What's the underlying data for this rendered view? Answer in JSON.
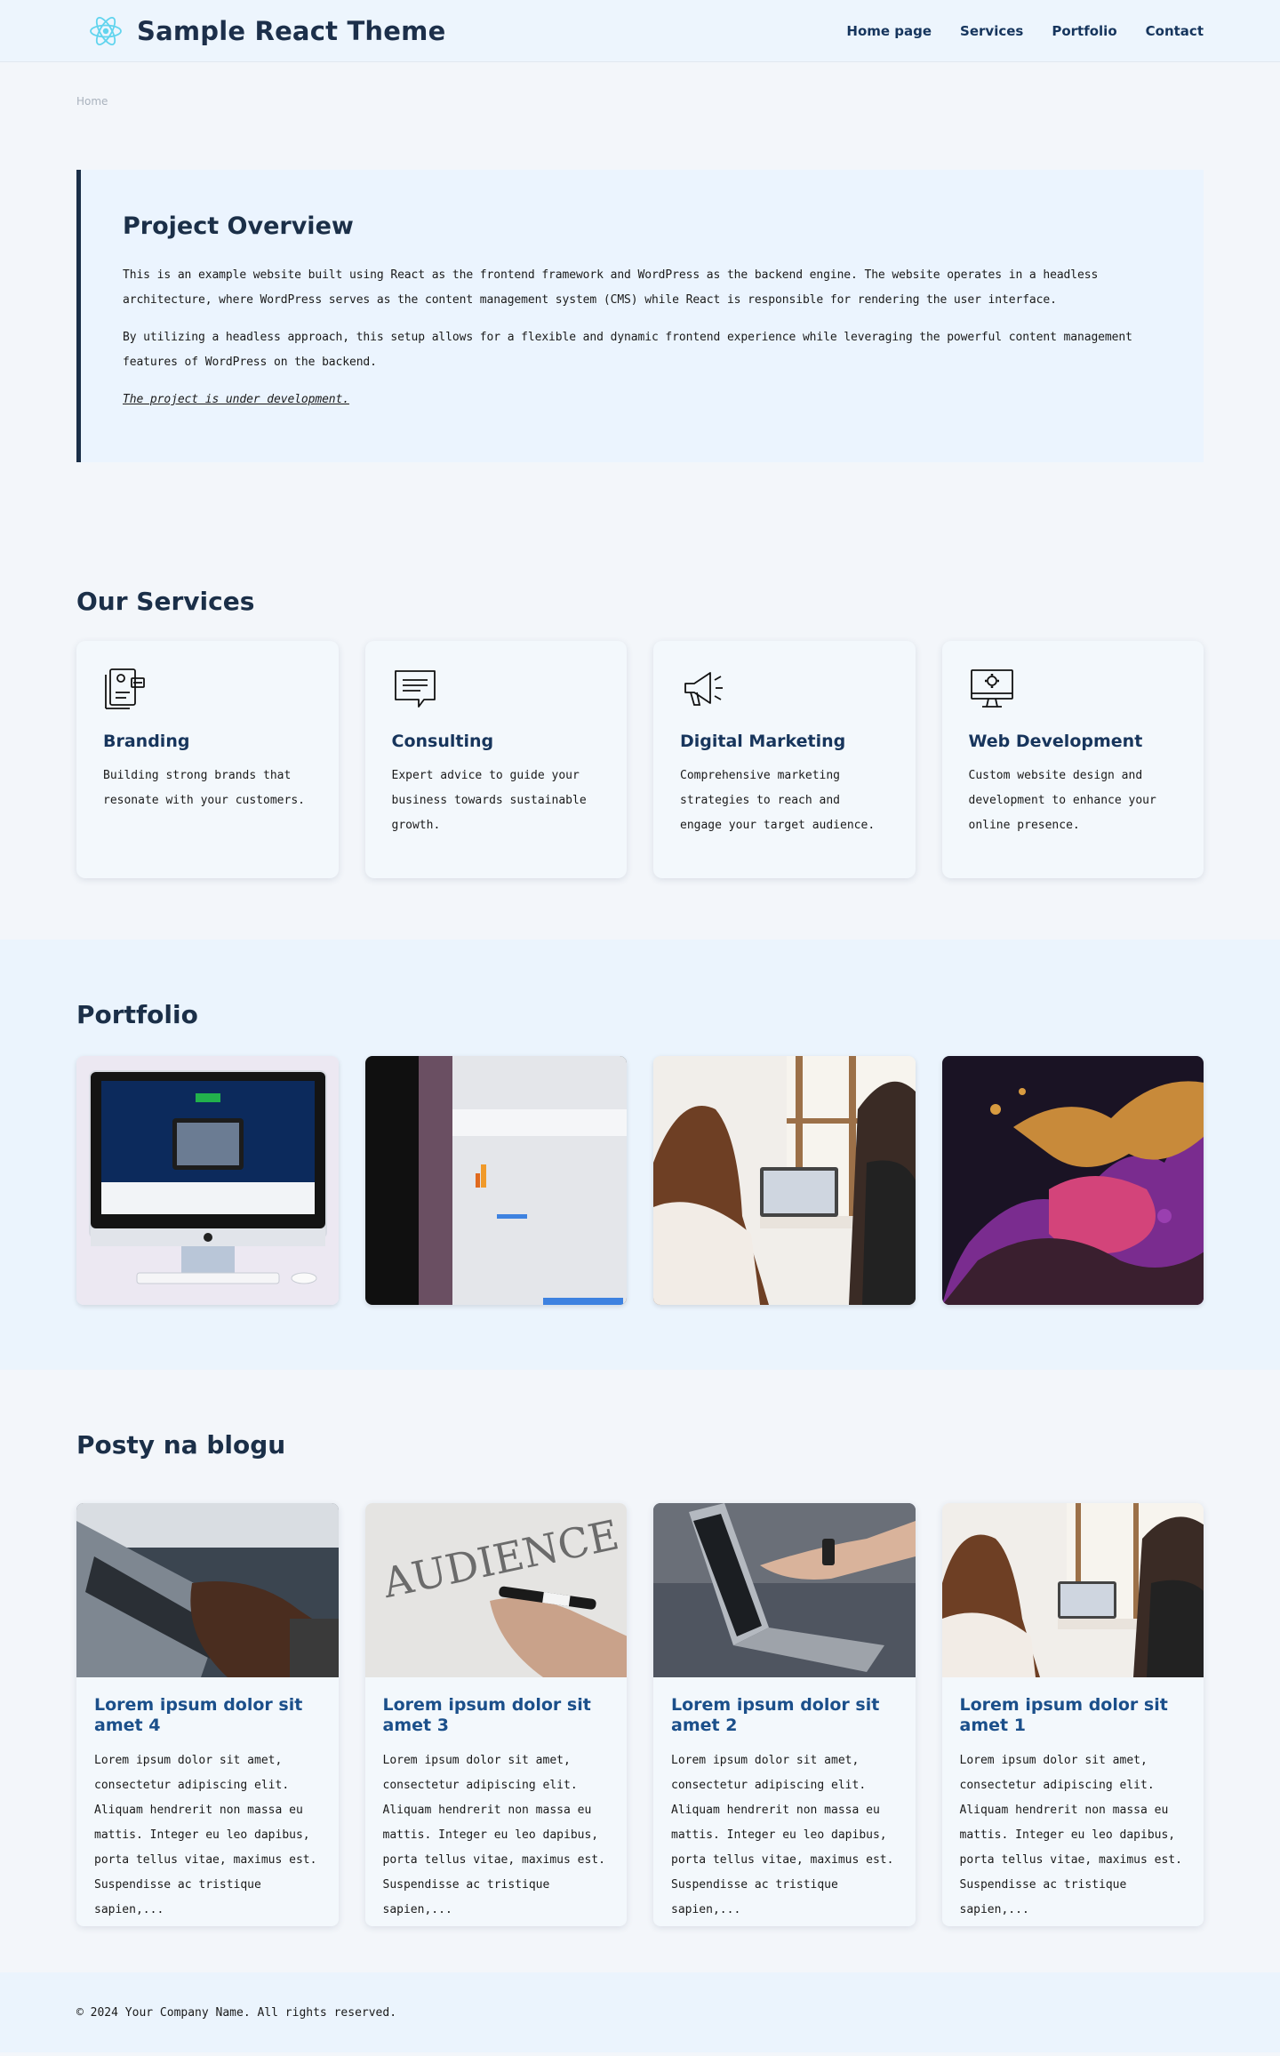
{
  "header": {
    "brand_title": "Sample React Theme",
    "logo_icon": "react-atom-icon",
    "nav": [
      {
        "label": "Home page"
      },
      {
        "label": "Services"
      },
      {
        "label": "Portfolio"
      },
      {
        "label": "Contact"
      }
    ]
  },
  "breadcrumb": "Home",
  "overview": {
    "title": "Project Overview",
    "p1": "This is an example website built using React as the frontend framework and WordPress as the backend engine. The website operates in a headless architecture, where WordPress serves as the content management system (CMS) while React is responsible for rendering the user interface.",
    "p2": "By utilizing a headless approach, this setup allows for a flexible and dynamic frontend experience while leveraging the powerful content management features of WordPress on the backend.",
    "note": "The project is under development."
  },
  "services": {
    "title": "Our Services",
    "items": [
      {
        "icon": "branding-icon",
        "title": "Branding",
        "text": "Building strong brands that resonate with your customers."
      },
      {
        "icon": "chat-bubble-icon",
        "title": "Consulting",
        "text": "Expert advice to guide your business towards sustainable growth."
      },
      {
        "icon": "megaphone-icon",
        "title": "Digital Marketing",
        "text": "Comprehensive marketing strategies to reach and engage your target audience."
      },
      {
        "icon": "monitor-gear-icon",
        "title": "Web Development",
        "text": "Custom website design and development to enhance your online presence."
      }
    ]
  },
  "portfolio": {
    "title": "Portfolio"
  },
  "blog": {
    "title": "Posty na blogu",
    "posts": [
      {
        "title": "Lorem ipsum dolor sit amet 4",
        "excerpt": "Lorem ipsum dolor sit amet, consectetur adipiscing elit. Aliquam hendrerit non massa eu mattis. Integer eu leo dapibus, porta tellus vitae, maximus est. Suspendisse ac tristique sapien,..."
      },
      {
        "title": "Lorem ipsum dolor sit amet 3",
        "excerpt": "Lorem ipsum dolor sit amet, consectetur adipiscing elit. Aliquam hendrerit non massa eu mattis. Integer eu leo dapibus, porta tellus vitae, maximus est. Suspendisse ac tristique sapien,..."
      },
      {
        "title": "Lorem ipsum dolor sit amet 2",
        "excerpt": "Lorem ipsum dolor sit amet, consectetur adipiscing elit. Aliquam hendrerit non massa eu mattis. Integer eu leo dapibus, porta tellus vitae, maximus est. Suspendisse ac tristique sapien,..."
      },
      {
        "title": "Lorem ipsum dolor sit amet 1",
        "excerpt": "Lorem ipsum dolor sit amet, consectetur adipiscing elit. Aliquam hendrerit non massa eu mattis. Integer eu leo dapibus, porta tellus vitae, maximus est. Suspendisse ac tristique sapien,..."
      }
    ]
  },
  "footer": {
    "copyright": "© 2024 Your Company Name. All rights reserved."
  }
}
